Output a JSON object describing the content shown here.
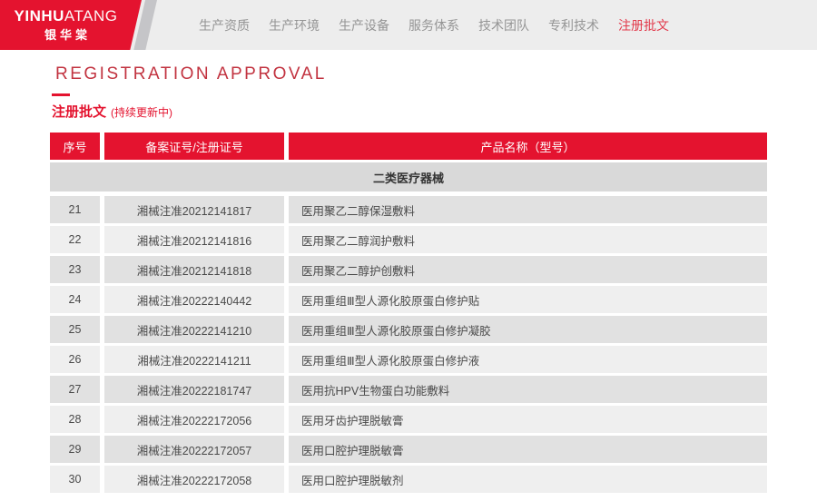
{
  "brand": {
    "name_bold": "YINHU",
    "name_light": "ATANG",
    "name_cn": "银华棠"
  },
  "nav": {
    "items": [
      {
        "label": "生产资质",
        "active": false
      },
      {
        "label": "生产环境",
        "active": false
      },
      {
        "label": "生产设备",
        "active": false
      },
      {
        "label": "服务体系",
        "active": false
      },
      {
        "label": "技术团队",
        "active": false
      },
      {
        "label": "专利技术",
        "active": false
      },
      {
        "label": "注册批文",
        "active": true
      }
    ]
  },
  "page": {
    "title_en": "REGISTRATION APPROVAL",
    "title_cn": "注册批文",
    "title_note": "(持续更新中)"
  },
  "table": {
    "headers": [
      "序号",
      "备案证号/注册证号",
      "产品名称（型号）"
    ],
    "category": "二类医疗器械",
    "rows": [
      {
        "no": "21",
        "cert": "湘械注准20212141817",
        "product": "医用聚乙二醇保湿敷料"
      },
      {
        "no": "22",
        "cert": "湘械注准20212141816",
        "product": "医用聚乙二醇润护敷料"
      },
      {
        "no": "23",
        "cert": "湘械注准20212141818",
        "product": "医用聚乙二醇护创敷料"
      },
      {
        "no": "24",
        "cert": "湘械注准20222140442",
        "product": "医用重组Ⅲ型人源化胶原蛋白修护贴"
      },
      {
        "no": "25",
        "cert": "湘械注准20222141210",
        "product": "医用重组Ⅲ型人源化胶原蛋白修护凝胶"
      },
      {
        "no": "26",
        "cert": "湘械注准20222141211",
        "product": "医用重组Ⅲ型人源化胶原蛋白修护液"
      },
      {
        "no": "27",
        "cert": "湘械注准20222181747",
        "product": "医用抗HPV生物蛋白功能敷料"
      },
      {
        "no": "28",
        "cert": "湘械注准20222172056",
        "product": "医用牙齿护理脱敏膏"
      },
      {
        "no": "29",
        "cert": "湘械注准20222172057",
        "product": "医用口腔护理脱敏膏"
      },
      {
        "no": "30",
        "cert": "湘械注准20222172058",
        "product": "医用口腔护理脱敏剂"
      }
    ]
  },
  "colors": {
    "brand_red": "#e4132f",
    "title_red": "#c23340",
    "nav_bg": "#ededed",
    "nav_text": "#959595",
    "nav_active": "#e23a4c",
    "stripe_gray": "#c5c5c8",
    "category_bg": "#d9d9d9",
    "row_dark": "#e1e1e1",
    "row_light": "#efefef",
    "cell_text": "#4a4a4a"
  }
}
